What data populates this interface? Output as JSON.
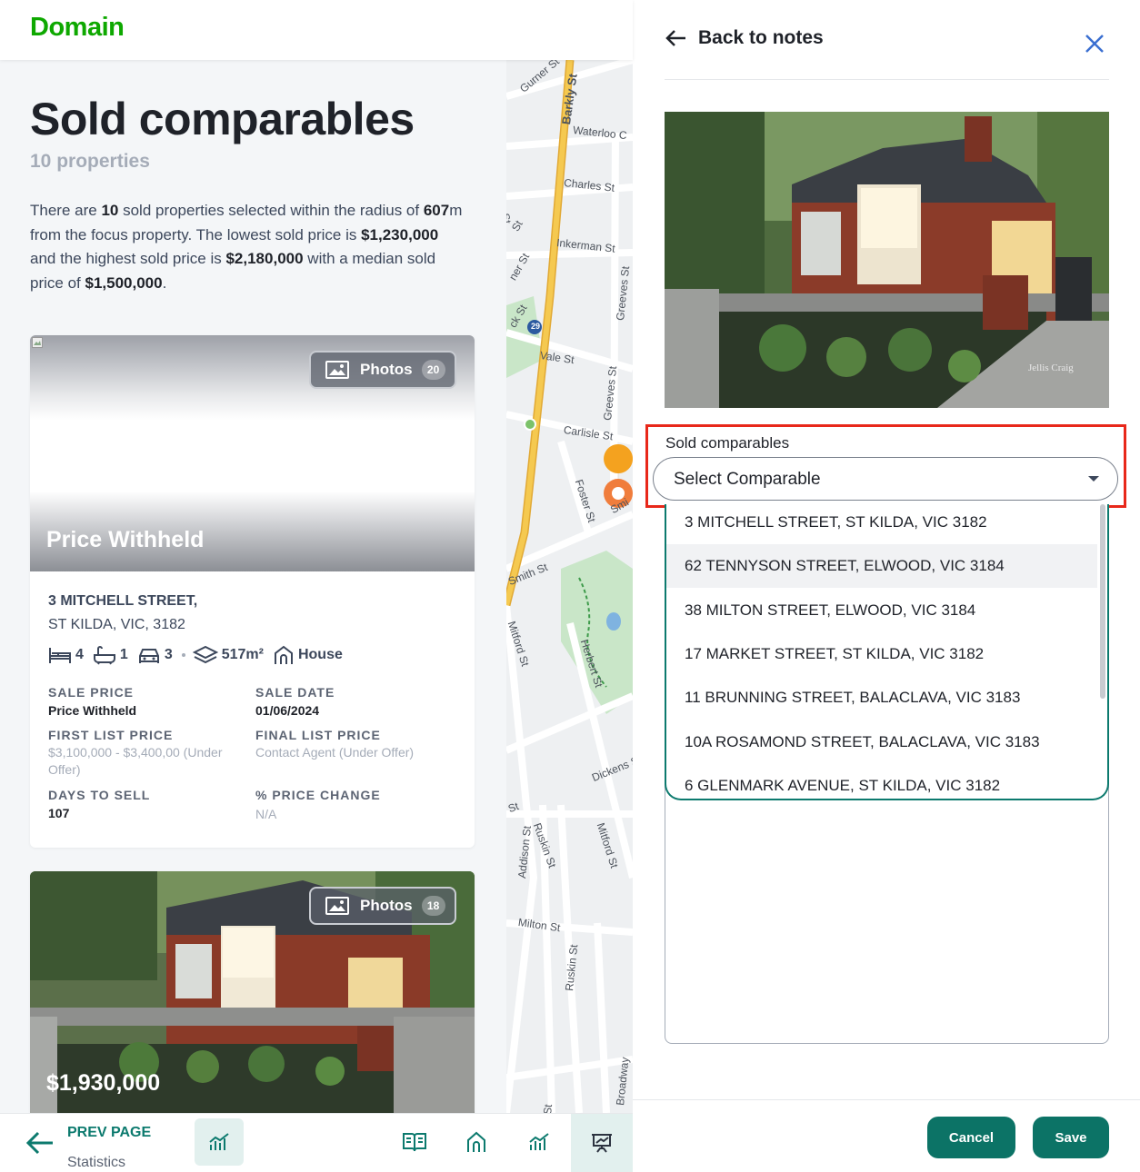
{
  "app": {
    "logo": "Domain"
  },
  "page": {
    "title": "Sold comparables",
    "subtitle": "10 properties",
    "summary": {
      "part1": "There are ",
      "count": "10",
      "part2": " sold properties selected within the radius of ",
      "radius": "607",
      "part3": "m from the focus property. The lowest sold price is ",
      "lowest": "$1,230,000",
      "part4": " and the highest sold price is ",
      "highest": "$2,180,000",
      "part5": " with a median sold price of ",
      "median": "$1,500,000",
      "part6": "."
    }
  },
  "cards": [
    {
      "photos_label": "Photos",
      "photos_count": "20",
      "price": "Price Withheld",
      "address_line1": "3 MITCHELL STREET,",
      "address_line2": "ST KILDA, VIC, 3182",
      "beds": "4",
      "baths": "1",
      "cars": "3",
      "land": "517m²",
      "type": "House",
      "sale_price_label": "SALE PRICE",
      "sale_price": "Price Withheld",
      "sale_date_label": "SALE DATE",
      "sale_date": "01/06/2024",
      "first_list_label": "FIRST LIST PRICE",
      "first_list": "$3,100,000 - $3,400,00 (Under Offer)",
      "final_list_label": "FINAL LIST PRICE",
      "final_list": "Contact Agent (Under Offer)",
      "days_label": "DAYS TO SELL",
      "days": "107",
      "change_label": "% PRICE CHANGE",
      "change": "N/A"
    },
    {
      "photos_label": "Photos",
      "photos_count": "18",
      "price": "$1,930,000"
    }
  ],
  "map": {
    "streets": [
      "Gurner St",
      "Barkly St",
      "Waterloo C",
      "Charles St",
      "Inkerman St",
      "Greeves St",
      "Vale St",
      "Greeves St",
      "Carlisle St",
      "Foster St",
      "Smith St",
      "Mitford St",
      "Herbert St",
      "Dickens St",
      "Ruskin St",
      "Addison St",
      "Mitford St",
      "Milton St",
      "Ruskin St",
      "Broadway",
      "ck St",
      "ner St",
      "rey St",
      "St",
      "St",
      "St",
      "St",
      "Smi"
    ],
    "route_number": "29"
  },
  "bottom_nav": {
    "prev_label": "PREV PAGE",
    "prev_sub": "Statistics"
  },
  "panel": {
    "back_label": "Back to notes",
    "field_label": "Sold comparables",
    "select_placeholder": "Select Comparable",
    "options": [
      "3 MITCHELL STREET, ST KILDA, VIC 3182",
      "62 TENNYSON STREET, ELWOOD, VIC 3184",
      "38 MILTON STREET, ELWOOD, VIC 3184",
      "17 MARKET STREET, ST KILDA, VIC 3182",
      "11 BRUNNING STREET, BALACLAVA, VIC 3183",
      "10A ROSAMOND STREET, BALACLAVA, VIC 3183",
      "6 GLENMARK AVENUE, ST KILDA, VIC 3182"
    ],
    "cancel_label": "Cancel",
    "save_label": "Save",
    "watermark": "Jellis Craig"
  },
  "colors": {
    "brand_green": "#0ea800",
    "teal": "#0c7366",
    "highlight_red": "#e8281a",
    "close_blue": "#3b6fd1"
  }
}
